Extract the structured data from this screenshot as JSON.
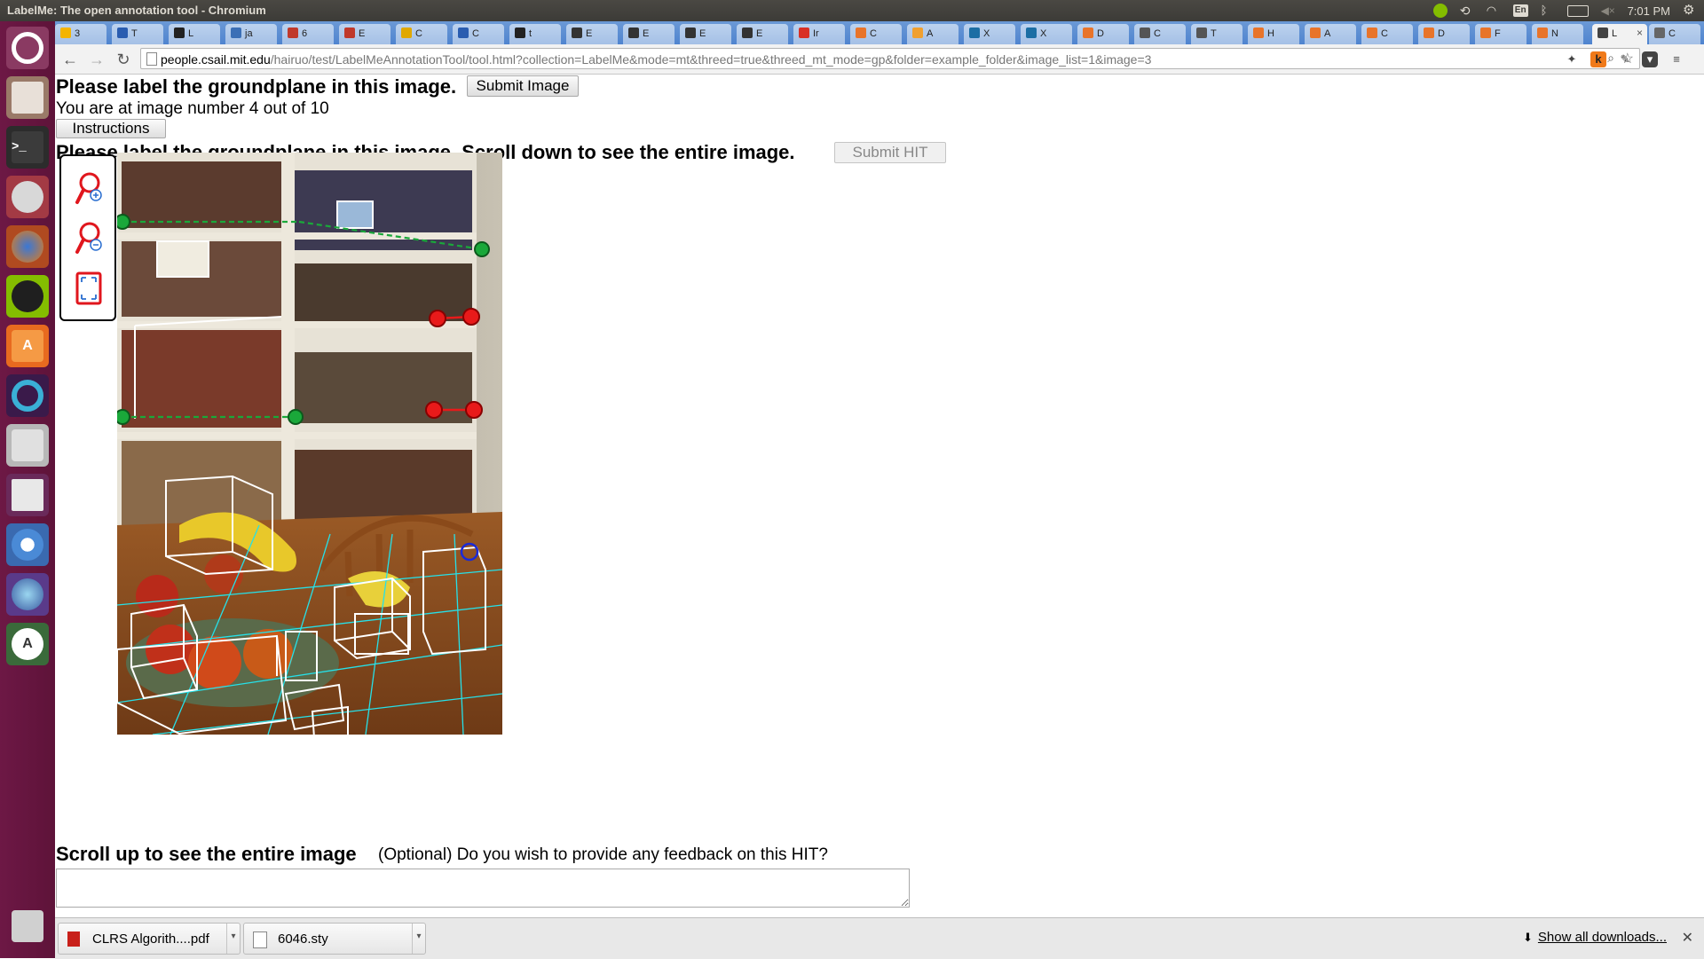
{
  "window": {
    "title": "LabelMe: The open annotation tool - Chromium",
    "time": "7:01 PM",
    "keyboard": "En"
  },
  "tabs": [
    {
      "label": "3",
      "icon": "google-drive-icon",
      "color": "#f4b400"
    },
    {
      "label": "T",
      "icon": "doc-icon",
      "color": "#2a5db0"
    },
    {
      "label": "L",
      "icon": "github-icon",
      "color": "#222222"
    },
    {
      "label": "ja",
      "icon": "shield-icon",
      "color": "#3b6fb6"
    },
    {
      "label": "6",
      "icon": "matlab-icon",
      "color": "#c0392b"
    },
    {
      "label": "E",
      "icon": "matlab-icon",
      "color": "#c0392b"
    },
    {
      "label": "C",
      "icon": "bee-icon",
      "color": "#e0a800"
    },
    {
      "label": "C",
      "icon": "doc-icon",
      "color": "#2a5db0"
    },
    {
      "label": "t",
      "icon": "github-icon",
      "color": "#222222"
    },
    {
      "label": "E",
      "icon": "w-icon",
      "color": "#333333"
    },
    {
      "label": "E",
      "icon": "w-icon",
      "color": "#333333"
    },
    {
      "label": "E",
      "icon": "w-icon",
      "color": "#333333"
    },
    {
      "label": "E",
      "icon": "w-icon",
      "color": "#333333"
    },
    {
      "label": "Ir",
      "icon": "gmail-icon",
      "color": "#d93025"
    },
    {
      "label": "C",
      "icon": "matlab-icon",
      "color": "#e8742a"
    },
    {
      "label": "A",
      "icon": "circle-icon",
      "color": "#f0a030"
    },
    {
      "label": "X",
      "icon": "w3-icon",
      "color": "#1c6ea4"
    },
    {
      "label": "X",
      "icon": "w3-icon",
      "color": "#1c6ea4"
    },
    {
      "label": "D",
      "icon": "matlab-icon",
      "color": "#e8742a"
    },
    {
      "label": "C",
      "icon": "wiki-icon",
      "color": "#555555"
    },
    {
      "label": "T",
      "icon": "wiki-icon",
      "color": "#555555"
    },
    {
      "label": "H",
      "icon": "matlab-icon",
      "color": "#e8742a"
    },
    {
      "label": "A",
      "icon": "matlab-icon",
      "color": "#e8742a"
    },
    {
      "label": "C",
      "icon": "matlab-icon",
      "color": "#e8742a"
    },
    {
      "label": "D",
      "icon": "matlab-icon",
      "color": "#e8742a"
    },
    {
      "label": "F",
      "icon": "matlab-icon",
      "color": "#e8742a"
    },
    {
      "label": "N",
      "icon": "matlab-icon",
      "color": "#e8742a"
    },
    {
      "label": "L",
      "icon": "labelme-icon",
      "color": "#444444",
      "active": true
    },
    {
      "label": "C",
      "icon": "page-icon",
      "color": "#666666"
    }
  ],
  "url": {
    "host": "people.csail.mit.edu",
    "path": "/hairuo/test/LabelMeAnnotationTool/tool.html?collection=LabelMe&mode=mt&threed=true&threed_mt_mode=gp&folder=example_folder&image_list=1&image=3"
  },
  "page": {
    "heading": "Please label the groundplane in this image.",
    "submit_image": "Submit Image",
    "progress_text": "You are at image number 4 out of 10",
    "instructions": "Instructions",
    "heading2": "Please label the groundplane in this image. Scroll down to see the entire image.",
    "submit_hit": "Submit HIT",
    "scroll_up": "Scroll up to see the entire image",
    "feedback_prompt": "(Optional) Do you wish to provide any feedback on this HIT?",
    "feedback_value": ""
  },
  "downloads": {
    "items": [
      {
        "name": "CLRS Algorith....pdf",
        "icon": "pdf-icon"
      },
      {
        "name": "6046.sty",
        "icon": "file-icon"
      }
    ],
    "show_all": "Show all downloads..."
  }
}
